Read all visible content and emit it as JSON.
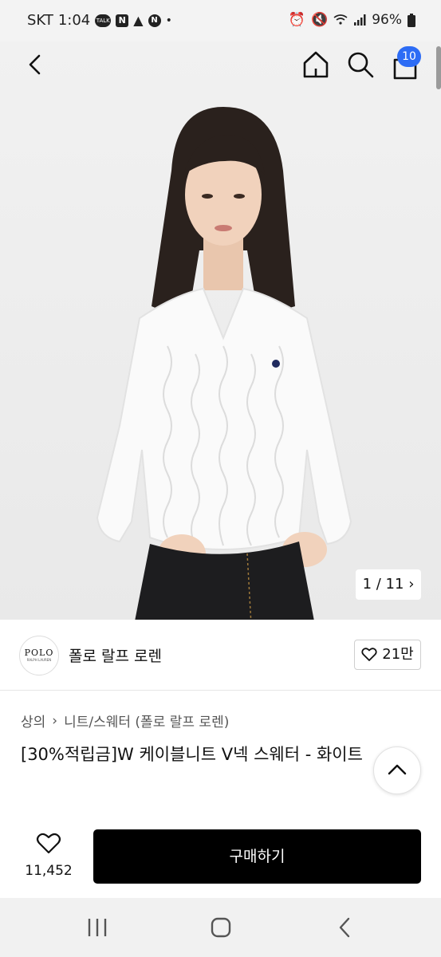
{
  "status_bar": {
    "carrier": "SKT",
    "time": "1:04",
    "battery": "96%",
    "notification_icons": [
      "talk-icon",
      "naver-icon",
      "warning-icon",
      "naver-circle-icon"
    ],
    "system_icons": [
      "alarm-icon",
      "mute-icon",
      "wifi-icon",
      "signal-icon",
      "battery-icon"
    ]
  },
  "top_nav": {
    "cart_count": "10"
  },
  "gallery": {
    "pager": "1 / 11"
  },
  "brand": {
    "logo_text": "POLO",
    "logo_subtext": "RALPH LAUREN",
    "name": "폴로 랄프 로렌",
    "likes": "21만"
  },
  "breadcrumb": {
    "category": "상의",
    "subcategory": "니트/스웨터 (폴로 랄프 로렌)"
  },
  "product": {
    "title": "[30%적립금]W 케이블니트 V넥 스웨터 - 화이트"
  },
  "buy_bar": {
    "wish_count": "11,452",
    "buy_label": "구매하기"
  },
  "colors": {
    "cart_badge": "#2d6cf5",
    "buy_button": "#000000"
  }
}
